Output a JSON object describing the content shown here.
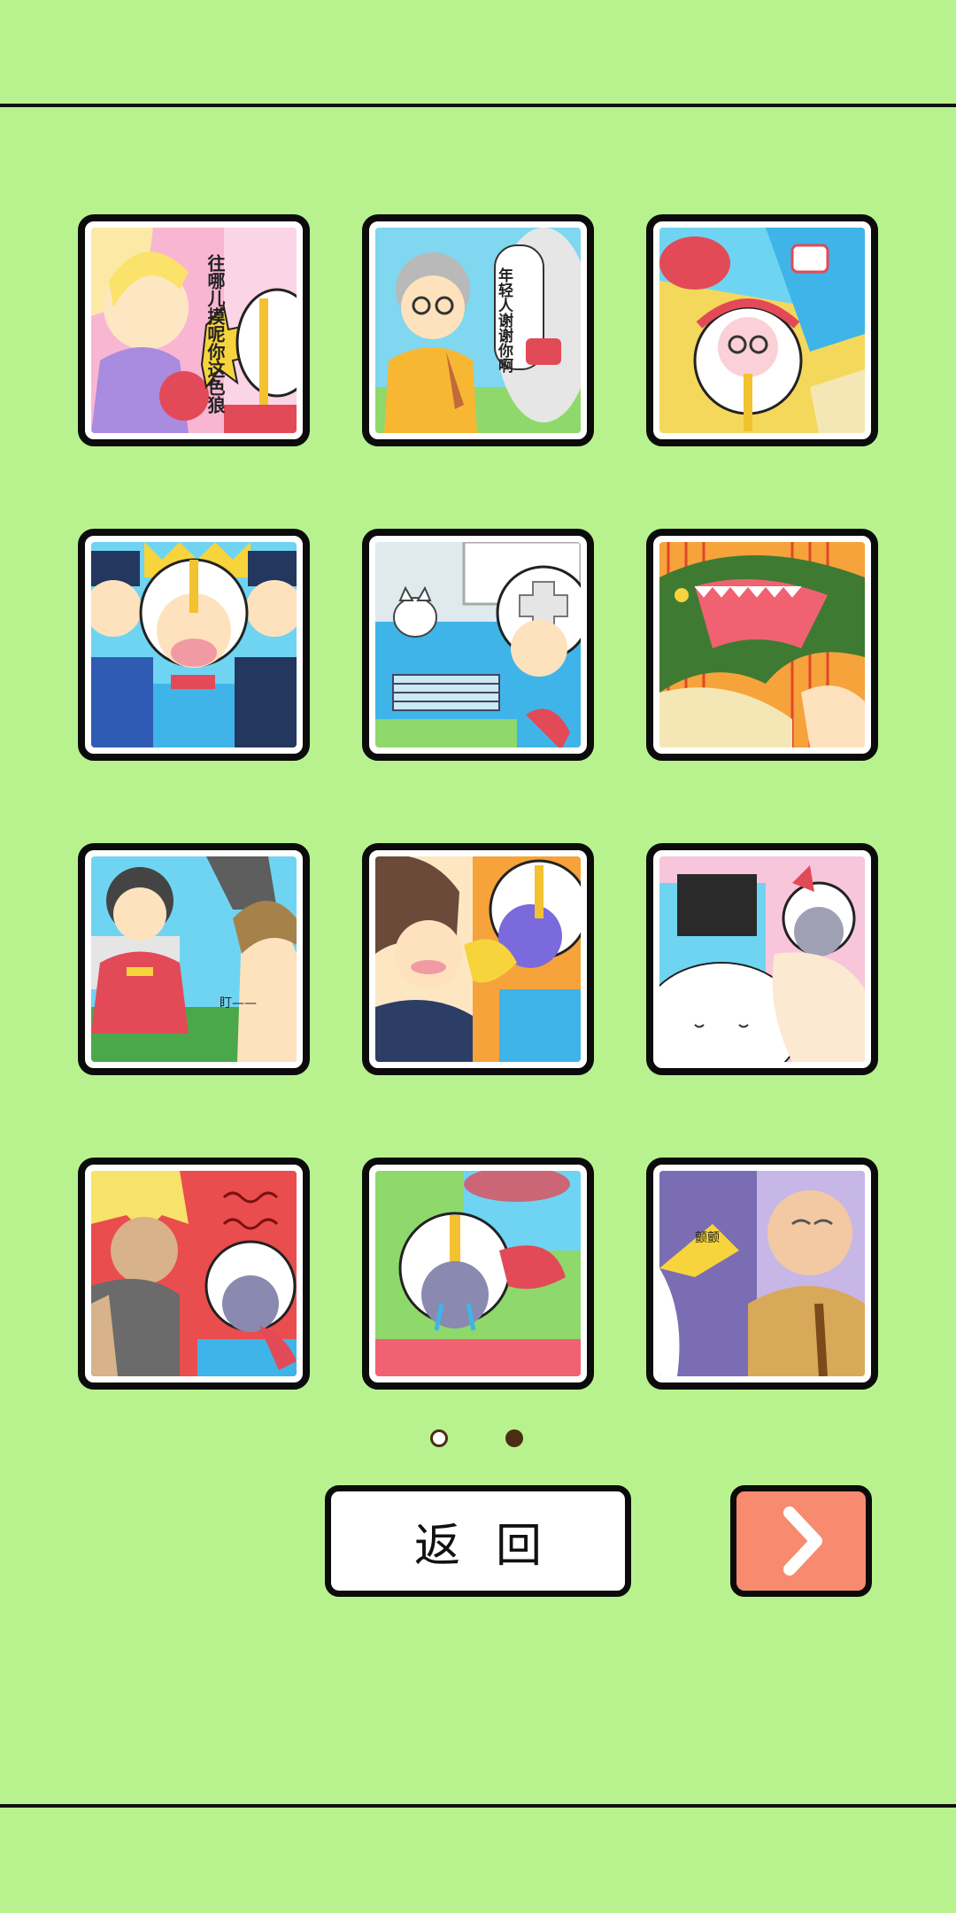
{
  "gallery": {
    "tiles": [
      {
        "name": "angry-blonde-woman-comic",
        "speech_text": "往哪儿摸呢你这色狼"
      },
      {
        "name": "grandma-thanks-comic",
        "speech_text": "年轻人谢谢你啊"
      },
      {
        "name": "dizzy-helmet-hero-comic"
      },
      {
        "name": "arrested-by-police-comic"
      },
      {
        "name": "cat-on-car-comic"
      },
      {
        "name": "crocodile-attack-comic"
      },
      {
        "name": "kimono-girl-staring-comic",
        "speech_text": "盯——"
      },
      {
        "name": "blushing-office-man-comic"
      },
      {
        "name": "sumo-hug-comic"
      },
      {
        "name": "blonde-thug-comic"
      },
      {
        "name": "crying-helmet-hero-comic"
      },
      {
        "name": "old-man-with-cane-comic",
        "speech_text": "颤颤"
      }
    ]
  },
  "pagination": {
    "current": 2,
    "total": 2
  },
  "buttons": {
    "back_label": "返回",
    "next_icon": "chevron-right-icon"
  },
  "colors": {
    "background": "#b8f28f",
    "next_button": "#f78a6f",
    "border": "#0b0b0b",
    "dot": "#4b2e12"
  }
}
